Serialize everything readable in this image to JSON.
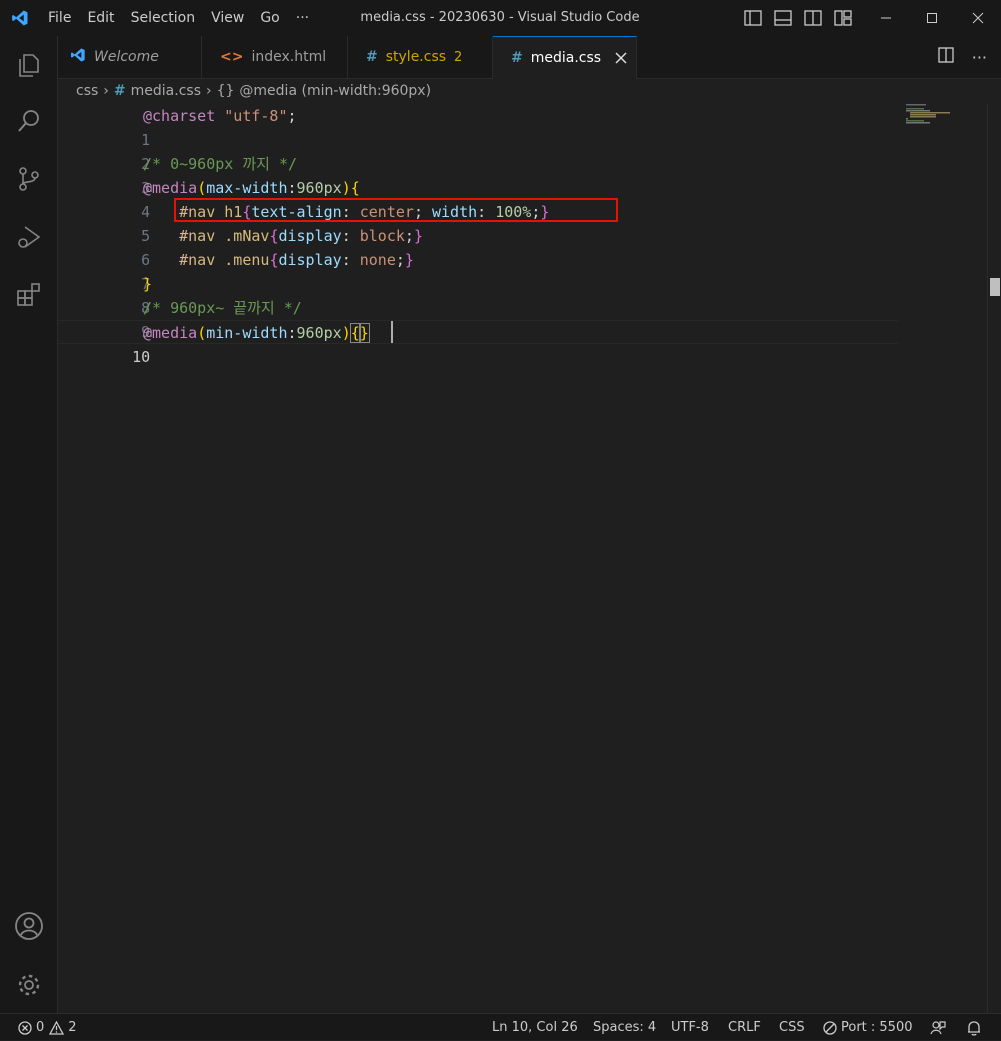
{
  "titlebar": {
    "menu": [
      "File",
      "Edit",
      "Selection",
      "View",
      "Go",
      "···"
    ],
    "title": "media.css - 20230630 - Visual Studio Code"
  },
  "tabs": [
    {
      "icon": "vscode-icon",
      "label": "Welcome",
      "active": false
    },
    {
      "icon": "html-icon",
      "glyph": "<>",
      "label": "index.html",
      "active": false
    },
    {
      "icon": "css-icon",
      "glyph": "#",
      "label": "style.css",
      "badge": "2",
      "active": false
    },
    {
      "icon": "css-icon",
      "glyph": "#",
      "label": "media.css",
      "active": true
    }
  ],
  "breadcrumb": {
    "folder": "css",
    "file_glyph": "#",
    "file": "media.css",
    "symbol_glyph": "{}",
    "symbol": "@media (min-width:960px)"
  },
  "editor": {
    "lines": [
      {
        "n": "1"
      },
      {
        "n": "2"
      },
      {
        "n": "3"
      },
      {
        "n": "4"
      },
      {
        "n": "5"
      },
      {
        "n": "6"
      },
      {
        "n": "7"
      },
      {
        "n": "8"
      },
      {
        "n": "9"
      },
      {
        "n": "10"
      }
    ],
    "code": {
      "l1_at": "@charset",
      "l1_str": "\"utf-8\"",
      "l1_semi": ";",
      "l3": "/* 0~960px 까지 */",
      "l4_at": "@media",
      "l4_open": "(",
      "l4_prop": "max-width",
      "l4_colon": ":",
      "l4_num": "960px",
      "l4_close": ")",
      "l4_brace": "{",
      "l5_sel": "#nav h1",
      "l5_open": "{",
      "l5_p1": "text-align",
      "l5_c1": ": ",
      "l5_v1": "center",
      "l5_s1": "; ",
      "l5_p2": "width",
      "l5_c2": ": ",
      "l5_v2": "100%",
      "l5_s2": ";",
      "l5_close": "}",
      "l6_sel": "#nav .mNav",
      "l6_open": "{",
      "l6_p": "display",
      "l6_c": ": ",
      "l6_v": "block",
      "l6_s": ";",
      "l6_close": "}",
      "l7_sel": "#nav .menu",
      "l7_open": "{",
      "l7_p": "display",
      "l7_c": ": ",
      "l7_v": "none",
      "l7_s": ";",
      "l7_close": "}",
      "l8": "}",
      "l9": "/* 960px~ 끝까지 */",
      "l10_at": "@media",
      "l10_open": "(",
      "l10_prop": "min-width",
      "l10_colon": ":",
      "l10_num": "960px",
      "l10_close": ")",
      "l10_b1": "{",
      "l10_b2": "}"
    }
  },
  "statusbar": {
    "errors": "0",
    "warnings": "2",
    "position": "Ln 10, Col 26",
    "spaces": "Spaces: 4",
    "encoding": "UTF-8",
    "eol": "CRLF",
    "language": "CSS",
    "port": "Port : 5500"
  },
  "colors": {
    "accent": "#0078d4",
    "highlight_box": "#e51400",
    "html_icon": "#e37933",
    "css_icon": "#519aba",
    "warning_tab": "#cca700"
  }
}
